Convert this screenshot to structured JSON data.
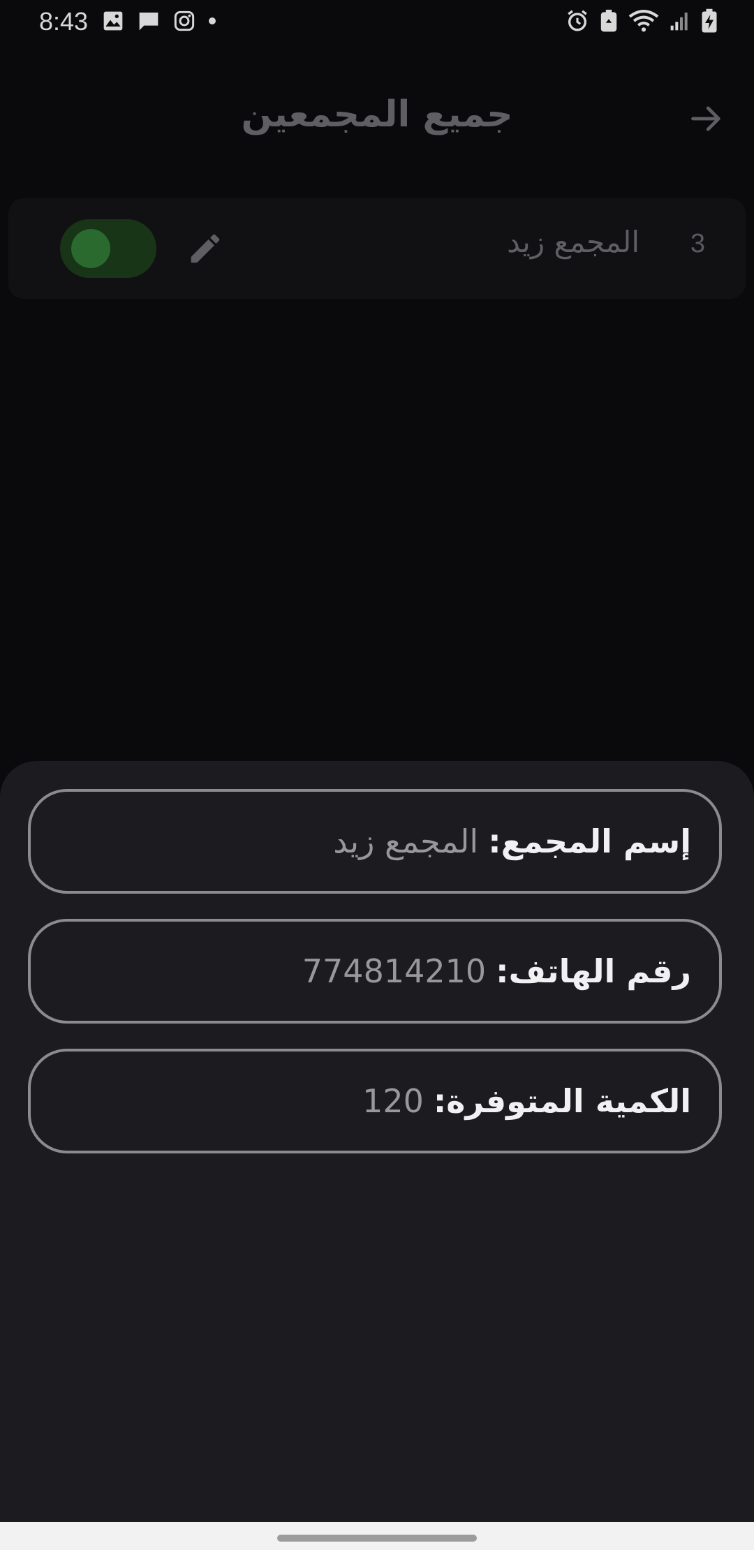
{
  "status_bar": {
    "time": "8:43"
  },
  "header": {
    "title": "جميع المجمعين",
    "back_icon": "arrow-right-icon"
  },
  "list": {
    "items": [
      {
        "index": "3",
        "name": "المجمع زيد",
        "toggle_on": true,
        "edit_icon": "pencil-icon"
      }
    ]
  },
  "details": {
    "name_label": "إسم المجمع:",
    "name_value": "المجمع زيد",
    "phone_label": "رقم الهاتف:",
    "phone_value": "774814210",
    "quantity_label": "الكمية المتوفرة:",
    "quantity_value": "120"
  },
  "colors": {
    "background": "#0a0a0c",
    "sheet": "#1c1b20",
    "toggle_track": "#183518",
    "toggle_knob": "#2b6a2e",
    "field_border": "#8c8b90"
  }
}
